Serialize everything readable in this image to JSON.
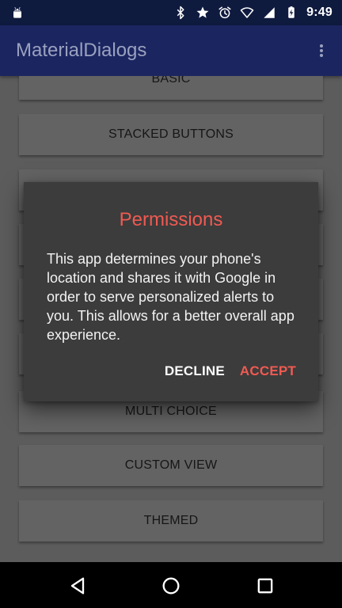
{
  "status_bar": {
    "time": "9:49",
    "icons": [
      "android-icon",
      "bluetooth-icon",
      "star-icon",
      "alarm-icon",
      "wifi-icon",
      "signal-icon",
      "battery-charging-icon"
    ]
  },
  "app_bar": {
    "title": "MaterialDialogs",
    "menu_icon": "overflow-menu-icon"
  },
  "list": {
    "items": [
      {
        "label": "BASIC"
      },
      {
        "label": "STACKED BUTTONS"
      },
      {
        "label": ""
      },
      {
        "label": ""
      },
      {
        "label": ""
      },
      {
        "label": ""
      },
      {
        "label": "MULTI CHOICE"
      },
      {
        "label": "CUSTOM VIEW"
      },
      {
        "label": "THEMED"
      }
    ]
  },
  "dialog": {
    "title": "Permissions",
    "message": "This app determines your phone's location and shares it with Google in order to serve personalized alerts to you. This allows for a better overall app experience.",
    "actions": {
      "negative": "DECLINE",
      "positive": "ACCEPT"
    },
    "colors": {
      "accent": "#f05a52",
      "background": "#3c3c3c",
      "text": "#f2f2f2"
    }
  },
  "nav_bar": {
    "icons": [
      "back-icon",
      "home-icon",
      "recents-icon"
    ]
  }
}
